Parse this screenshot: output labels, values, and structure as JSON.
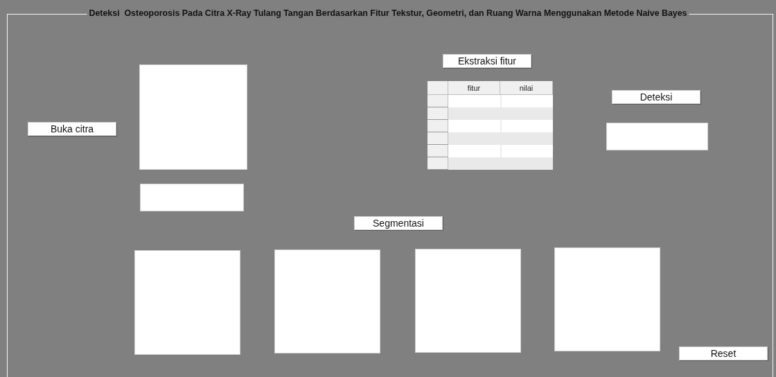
{
  "panel": {
    "title": "Deteksi  Osteoporosis Pada Citra X-Ray Tulang Tangan Berdasarkan Fitur Tekstur, Geometri, dan Ruang Warna Menggunakan Metode Naive Bayes"
  },
  "buttons": [
    {
      "label": "Buka citra",
      "kind": "open"
    },
    {
      "label": "Ekstraksi fitur",
      "kind": "extract"
    },
    {
      "label": "Deteksi",
      "kind": "detect"
    },
    {
      "label": "Segmentasi",
      "kind": "segment"
    },
    {
      "label": "Reset",
      "kind": "reset"
    }
  ],
  "table": {
    "columns": [
      "fitur",
      "nilai"
    ]
  }
}
